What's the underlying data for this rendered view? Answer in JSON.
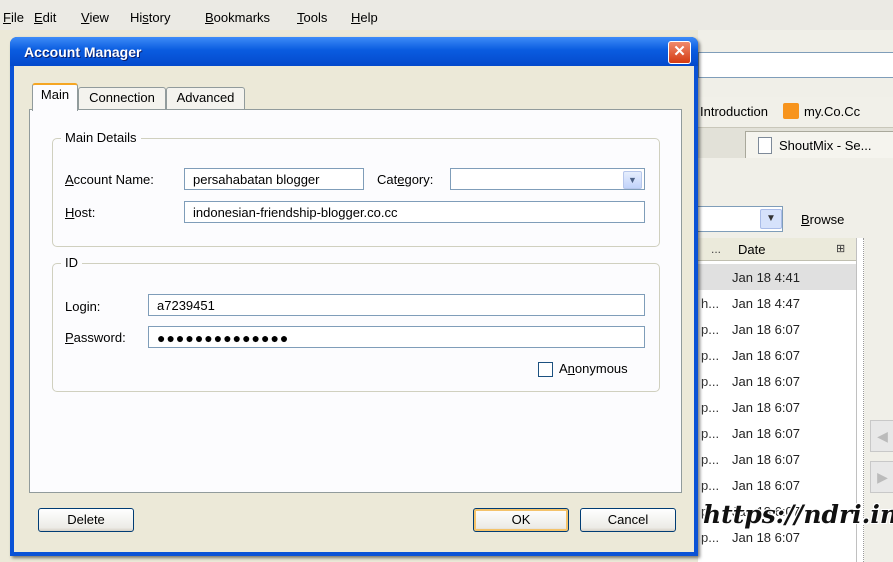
{
  "menubar": {
    "items": [
      {
        "label": "File",
        "accesskey": "F",
        "rest": "ile"
      },
      {
        "label": "Edit",
        "accesskey": "E",
        "rest": "dit"
      },
      {
        "label": "View",
        "accesskey": "V",
        "rest": "iew"
      },
      {
        "label": "History",
        "pre": "Hi",
        "accesskey": "s",
        "rest": "tory"
      },
      {
        "label": "Bookmarks",
        "accesskey": "B",
        "rest": "ookmarks"
      },
      {
        "label": "Tools",
        "accesskey": "T",
        "rest": "ools"
      },
      {
        "label": "Help",
        "accesskey": "H",
        "rest": "elp"
      }
    ]
  },
  "browser": {
    "bookmarks": [
      "Introduction",
      "my.Co.Cc"
    ],
    "tab_label": "ShoutMix - Se...",
    "browse_label": {
      "accesskey": "B",
      "rest": "rowse"
    },
    "list_header": {
      "dots": "...",
      "date": "Date"
    },
    "list_rows": [
      {
        "prefix": "",
        "date": "Jan 18 4:41",
        "selected": true
      },
      {
        "prefix": "h...",
        "date": "Jan 18 4:47"
      },
      {
        "prefix": "p...",
        "date": "Jan 18 6:07"
      },
      {
        "prefix": "p...",
        "date": "Jan 18 6:07"
      },
      {
        "prefix": "p...",
        "date": "Jan 18 6:07"
      },
      {
        "prefix": "p...",
        "date": "Jan 18 6:07"
      },
      {
        "prefix": "p...",
        "date": "Jan 18 6:07"
      },
      {
        "prefix": "p...",
        "date": "Jan 18 6:07"
      },
      {
        "prefix": "p...",
        "date": "Jan 18 6:07"
      },
      {
        "prefix": "p...",
        "date": "Jan 18 6:07"
      },
      {
        "prefix": "p...",
        "date": "Jan 18 6:07"
      }
    ],
    "watermark": "https://ndri.info"
  },
  "dialog": {
    "title": "Account Manager",
    "tabs": [
      "Main",
      "Connection",
      "Advanced"
    ],
    "main_details": {
      "legend": "Main Details",
      "account_name_label": {
        "accesskey": "A",
        "rest": "ccount Name:"
      },
      "account_name_value": "persahabatan blogger",
      "category_label": {
        "pre": "Cat",
        "accesskey": "e",
        "rest": "gory:"
      },
      "category_value": "",
      "host_label": {
        "accesskey": "H",
        "rest": "ost:"
      },
      "host_value": "indonesian-friendship-blogger.co.cc"
    },
    "id": {
      "legend": "ID",
      "login_label": "Login:",
      "login_value": "a7239451",
      "password_label": {
        "accesskey": "P",
        "rest": "assword:"
      },
      "password_value": "●●●●●●●●●●●●●●",
      "anonymous_label": {
        "pre": "A",
        "accesskey": "n",
        "rest": "onymous"
      },
      "anonymous_checked": false
    },
    "buttons": {
      "delete": "Delete",
      "ok": "OK",
      "cancel": "Cancel"
    }
  }
}
